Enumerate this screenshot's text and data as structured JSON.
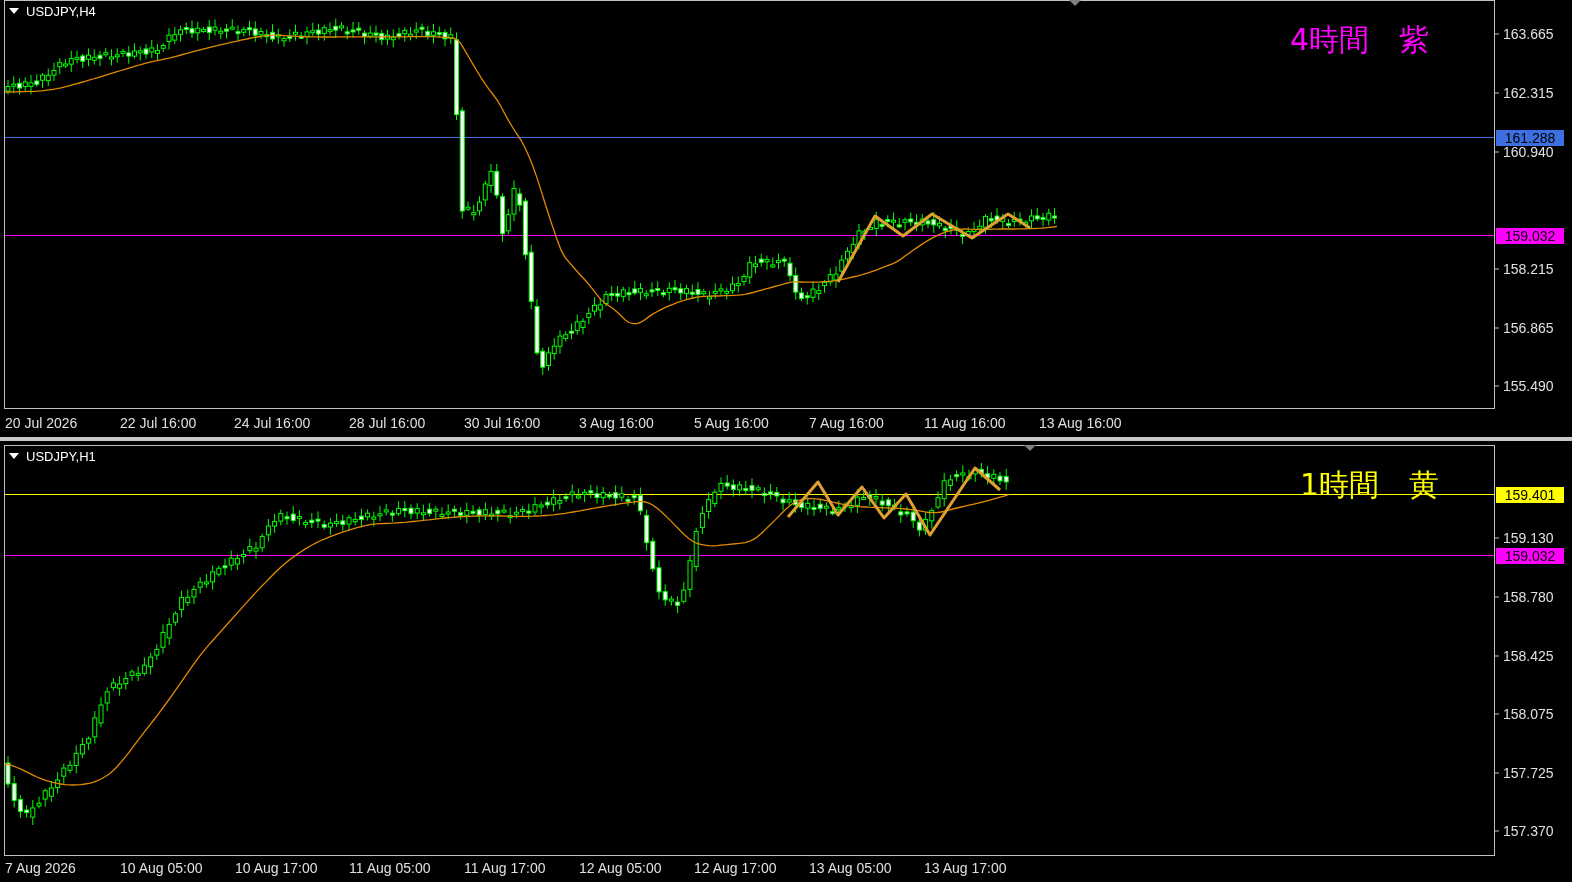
{
  "panels": [
    {
      "title": "USDJPY,H4",
      "note": {
        "text": "4時間　紫",
        "color": "#ff00ff"
      },
      "price_labels": [
        "163.665",
        "162.315",
        "160.940",
        "158.215",
        "156.865",
        "155.490"
      ],
      "price_lines": [
        {
          "label": "161.288",
          "color": "#3d6fe0"
        },
        {
          "label": "159.032",
          "color": "#ff00ff"
        }
      ],
      "time_labels": [
        "20 Jul 2026",
        "22 Jul 16:00",
        "24 Jul 16:00",
        "28 Jul 16:00",
        "30 Jul 16:00",
        "3 Aug 16:00",
        "5 Aug 16:00",
        "7 Aug 16:00",
        "11 Aug 16:00",
        "13 Aug 16:00"
      ]
    },
    {
      "title": "USDJPY,H1",
      "note": {
        "text": "1時間　黄",
        "color": "#ffff00"
      },
      "price_labels": [
        "159.130",
        "158.780",
        "158.425",
        "158.075",
        "157.725",
        "157.370"
      ],
      "price_lines": [
        {
          "label": "159.401",
          "color": "#ffff00"
        },
        {
          "label": "159.032",
          "color": "#ff00ff"
        }
      ],
      "time_labels": [
        "7 Aug 2026",
        "10 Aug 05:00",
        "10 Aug 17:00",
        "11 Aug 05:00",
        "11 Aug 17:00",
        "12 Aug 05:00",
        "12 Aug 17:00",
        "13 Aug 05:00",
        "13 Aug 17:00"
      ]
    }
  ]
}
